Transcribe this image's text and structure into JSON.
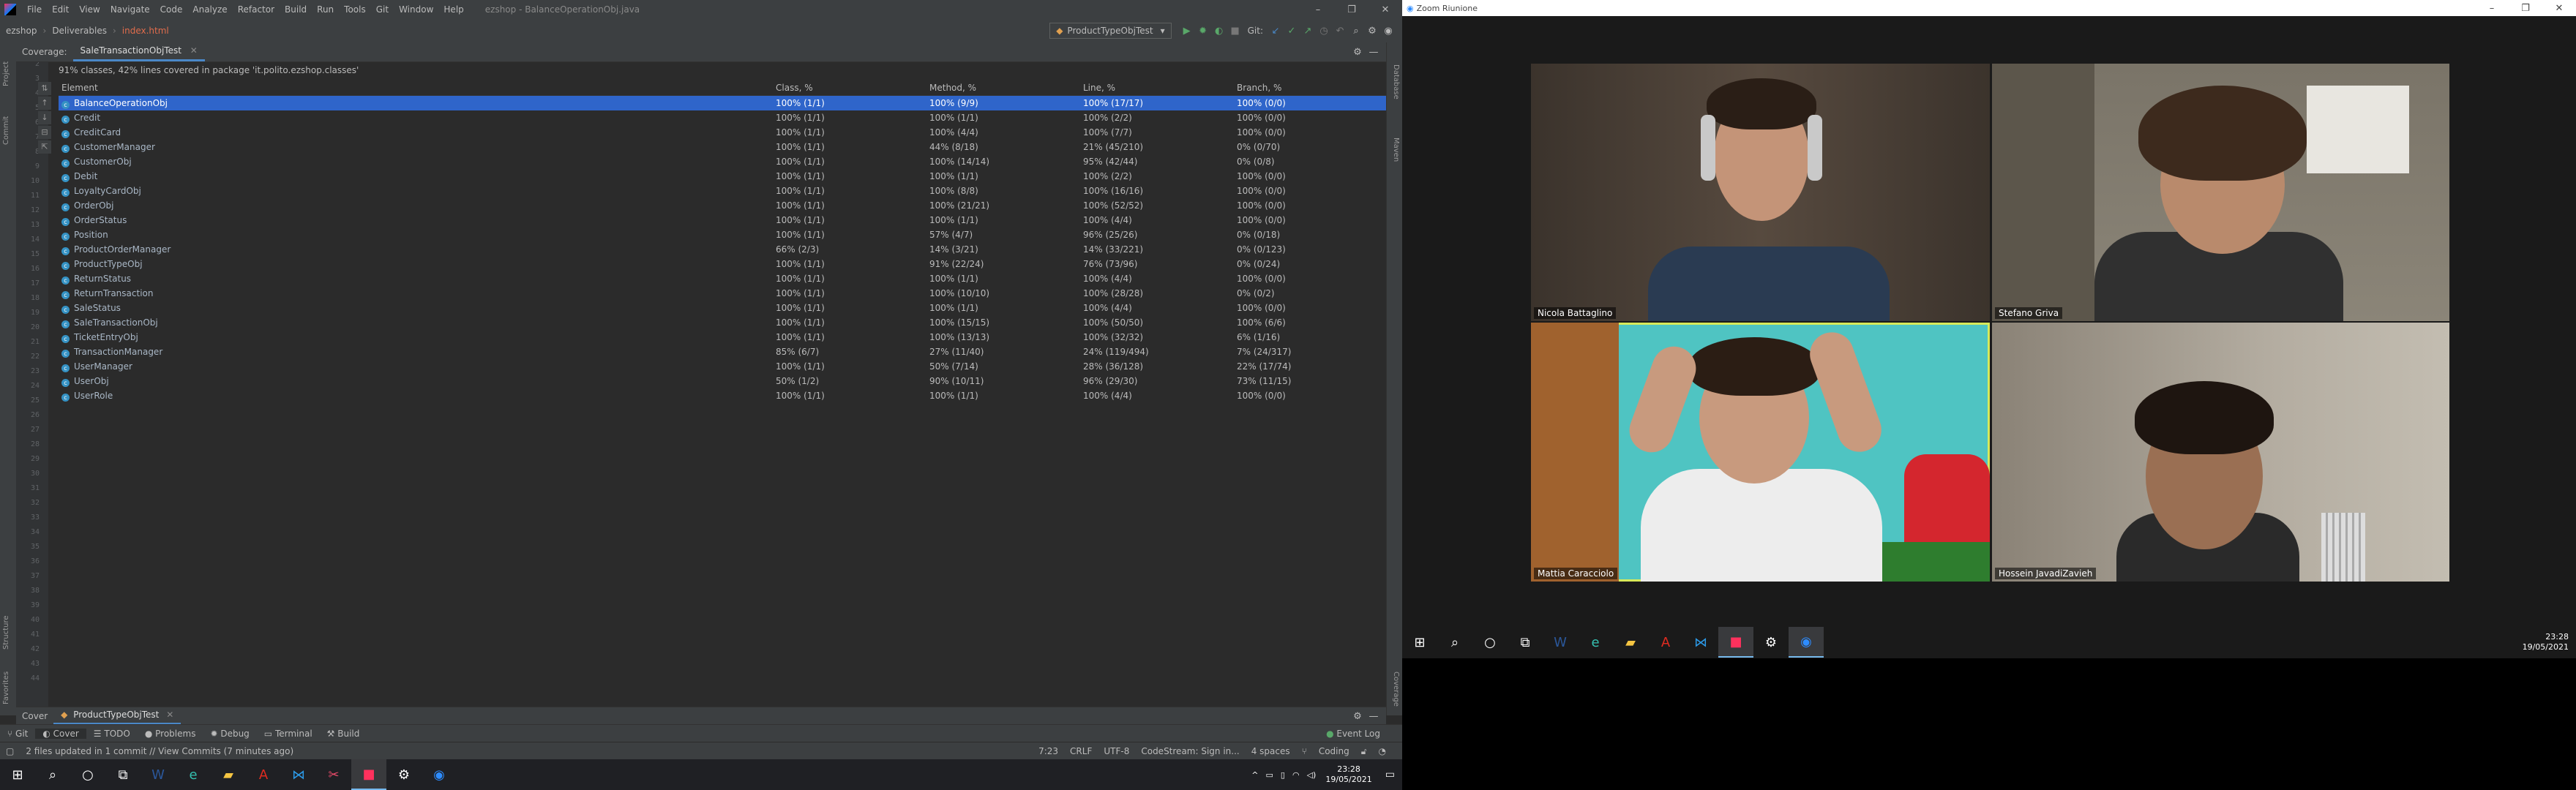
{
  "ide": {
    "menu": [
      "File",
      "Edit",
      "View",
      "Navigate",
      "Code",
      "Analyze",
      "Refactor",
      "Build",
      "Run",
      "Tools",
      "Git",
      "Window",
      "Help"
    ],
    "file_title": "ezshop - BalanceOperationObj.java",
    "breadcrumbs": [
      "ezshop",
      "Deliverables",
      "index.html"
    ],
    "run_config": "ProductTypeObjTest",
    "git_label": "Git:",
    "left_tool_windows": [
      "Project",
      "Commit",
      "Structure",
      "Favorites"
    ],
    "right_tool_windows": [
      "Database",
      "Maven",
      "Coverage"
    ],
    "coverage": {
      "panel_label": "Coverage:",
      "tab": "SaleTransactionObjTest",
      "summary": "91% classes, 42% lines covered in package 'it.polito.ezshop.classes'",
      "columns": [
        "Element",
        "Class, %",
        "Method, %",
        "Line, %",
        "Branch, %"
      ],
      "rows": [
        {
          "name": "BalanceOperationObj",
          "cls": "100% (1/1)",
          "method": "100% (9/9)",
          "line": "100% (17/17)",
          "branch": "100% (0/0)"
        },
        {
          "name": "Credit",
          "cls": "100% (1/1)",
          "method": "100% (1/1)",
          "line": "100% (2/2)",
          "branch": "100% (0/0)"
        },
        {
          "name": "CreditCard",
          "cls": "100% (1/1)",
          "method": "100% (4/4)",
          "line": "100% (7/7)",
          "branch": "100% (0/0)"
        },
        {
          "name": "CustomerManager",
          "cls": "100% (1/1)",
          "method": "44% (8/18)",
          "line": "21% (45/210)",
          "branch": "0% (0/70)"
        },
        {
          "name": "CustomerObj",
          "cls": "100% (1/1)",
          "method": "100% (14/14)",
          "line": "95% (42/44)",
          "branch": "0% (0/8)"
        },
        {
          "name": "Debit",
          "cls": "100% (1/1)",
          "method": "100% (1/1)",
          "line": "100% (2/2)",
          "branch": "100% (0/0)"
        },
        {
          "name": "LoyaltyCardObj",
          "cls": "100% (1/1)",
          "method": "100% (8/8)",
          "line": "100% (16/16)",
          "branch": "100% (0/0)"
        },
        {
          "name": "OrderObj",
          "cls": "100% (1/1)",
          "method": "100% (21/21)",
          "line": "100% (52/52)",
          "branch": "100% (0/0)"
        },
        {
          "name": "OrderStatus",
          "cls": "100% (1/1)",
          "method": "100% (1/1)",
          "line": "100% (4/4)",
          "branch": "100% (0/0)"
        },
        {
          "name": "Position",
          "cls": "100% (1/1)",
          "method": "57% (4/7)",
          "line": "96% (25/26)",
          "branch": "0% (0/18)"
        },
        {
          "name": "ProductOrderManager",
          "cls": "66% (2/3)",
          "method": "14% (3/21)",
          "line": "14% (33/221)",
          "branch": "0% (0/123)"
        },
        {
          "name": "ProductTypeObj",
          "cls": "100% (1/1)",
          "method": "91% (22/24)",
          "line": "76% (73/96)",
          "branch": "0% (0/24)"
        },
        {
          "name": "ReturnStatus",
          "cls": "100% (1/1)",
          "method": "100% (1/1)",
          "line": "100% (4/4)",
          "branch": "100% (0/0)"
        },
        {
          "name": "ReturnTransaction",
          "cls": "100% (1/1)",
          "method": "100% (10/10)",
          "line": "100% (28/28)",
          "branch": "0% (0/2)"
        },
        {
          "name": "SaleStatus",
          "cls": "100% (1/1)",
          "method": "100% (1/1)",
          "line": "100% (4/4)",
          "branch": "100% (0/0)"
        },
        {
          "name": "SaleTransactionObj",
          "cls": "100% (1/1)",
          "method": "100% (15/15)",
          "line": "100% (50/50)",
          "branch": "100% (6/6)"
        },
        {
          "name": "TicketEntryObj",
          "cls": "100% (1/1)",
          "method": "100% (13/13)",
          "line": "100% (32/32)",
          "branch": "6% (1/16)"
        },
        {
          "name": "TransactionManager",
          "cls": "85% (6/7)",
          "method": "27% (11/40)",
          "line": "24% (119/494)",
          "branch": "7% (24/317)"
        },
        {
          "name": "UserManager",
          "cls": "100% (1/1)",
          "method": "50% (7/14)",
          "line": "28% (36/128)",
          "branch": "22% (17/74)"
        },
        {
          "name": "UserObj",
          "cls": "50% (1/2)",
          "method": "90% (10/11)",
          "line": "96% (29/30)",
          "branch": "73% (11/15)"
        },
        {
          "name": "UserRole",
          "cls": "100% (1/1)",
          "method": "100% (1/1)",
          "line": "100% (4/4)",
          "branch": "100% (0/0)"
        }
      ]
    },
    "bottom_tabs": {
      "first": "Cover",
      "second": "ProductTypeObjTest"
    },
    "tool_windows": [
      "Git",
      "Cover",
      "TODO",
      "Problems",
      "Debug",
      "Terminal",
      "Build"
    ],
    "event_log": "Event Log",
    "status": {
      "message": "2 files updated in 1 commit // View Commits (7 minutes ago)",
      "position": "7:23",
      "line_sep": "CRLF",
      "encoding": "UTF-8",
      "codestream": "CodeStream: Sign in...",
      "indent": "4 spaces",
      "mode": "Coding"
    }
  },
  "taskbar_left": {
    "time": "23:28",
    "date": "19/05/2021"
  },
  "zoom": {
    "title": "Zoom Riunione",
    "participants": [
      "Nicola Battaglino",
      "Stefano Griva",
      "Mattia Caracciolo",
      "Hossein JavadiZavieh"
    ],
    "taskbar_time": "23:28",
    "taskbar_date": "19/05/2021"
  },
  "colors": {
    "accent": "#2f65ca",
    "zoom_active": "#d7e95a",
    "taskbar": "#1f2024"
  }
}
